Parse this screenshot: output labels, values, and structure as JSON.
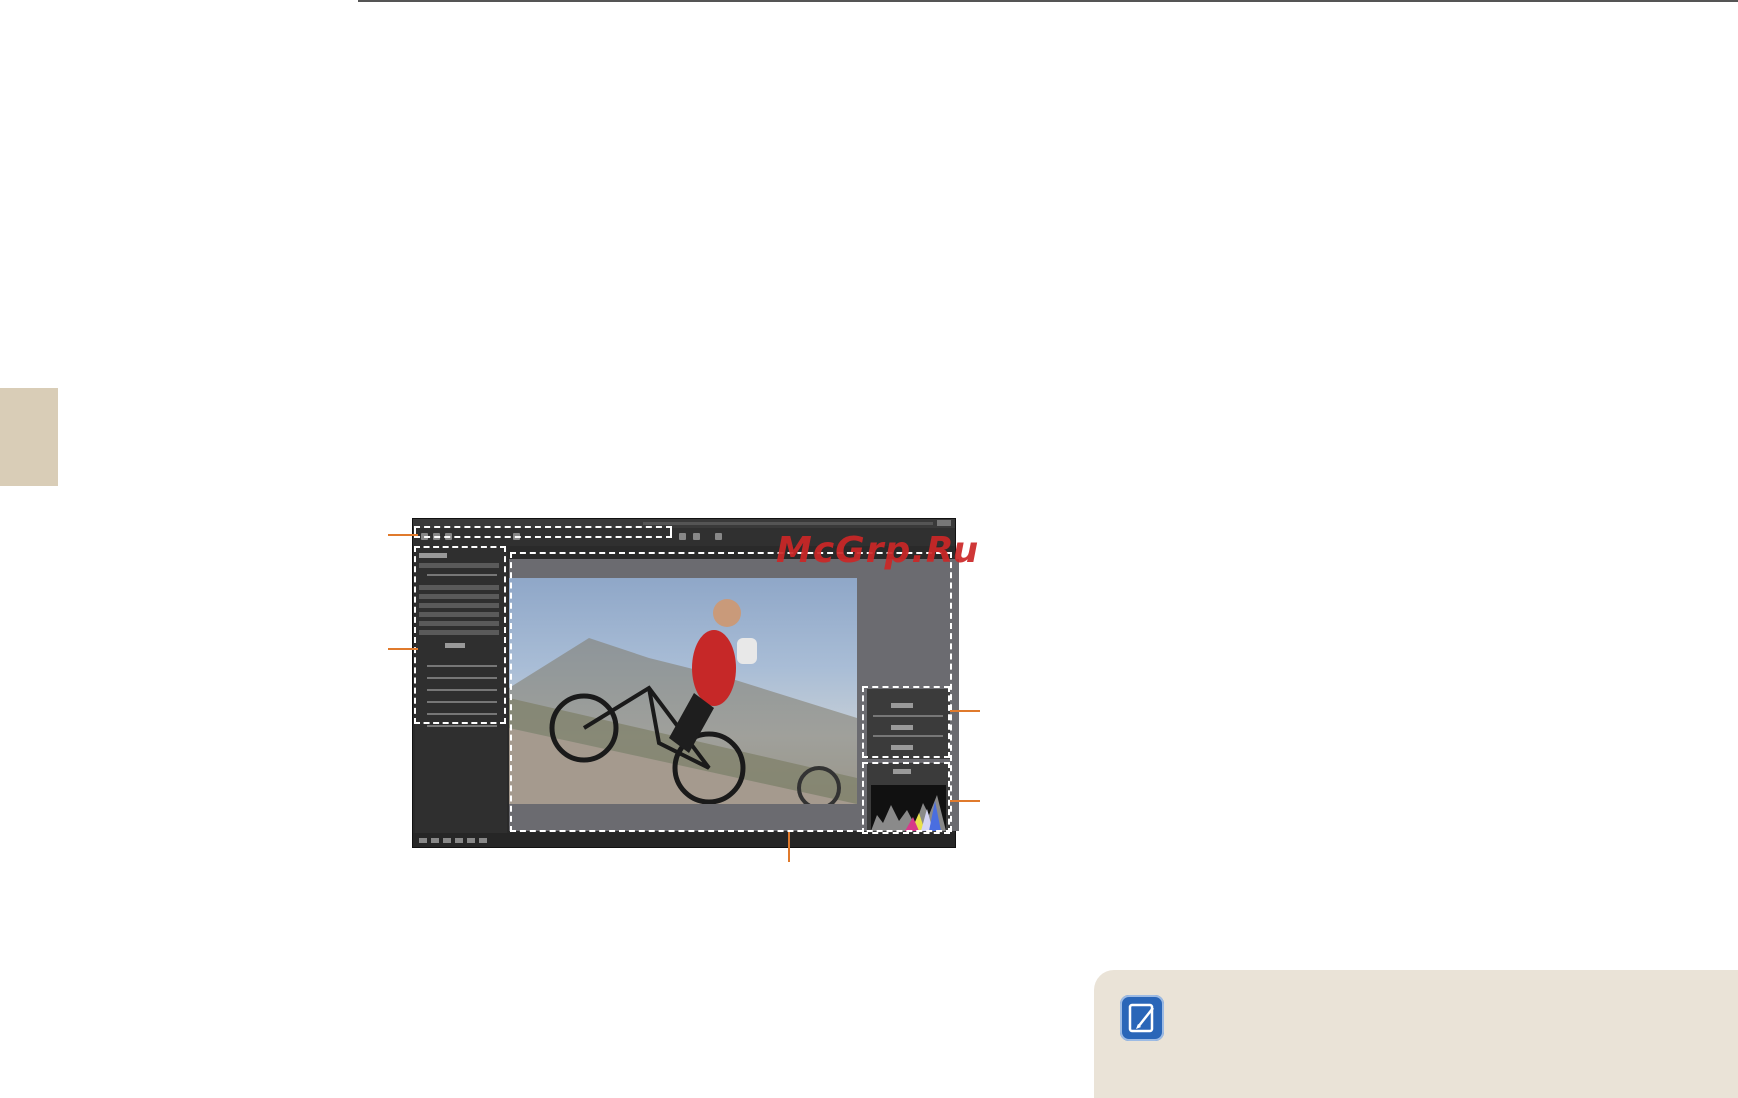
{
  "page": {
    "watermark": "McGrp.Ru"
  },
  "figure": {
    "accent_color": "#e07a2c",
    "photo_subject": "cyclist-photo",
    "note_icon": "note-pencil-icon"
  }
}
